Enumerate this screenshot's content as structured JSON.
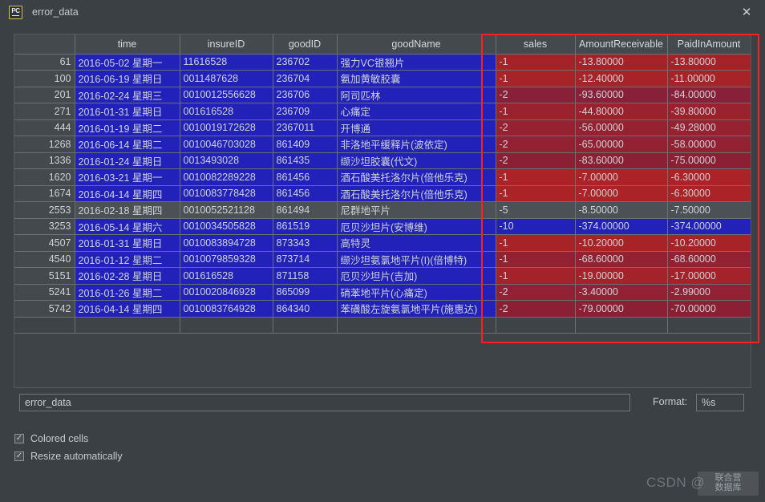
{
  "window": {
    "title": "error_data",
    "icon": "pc-app-icon",
    "close_label": "✕"
  },
  "table": {
    "columns": [
      "",
      "time",
      "insureID",
      "goodID",
      "goodName",
      "sales",
      "AmountReceivable",
      "PaidInAmount"
    ],
    "rows": [
      {
        "idx": "61",
        "time": "2016-05-02 星期一",
        "insureID": "11616528",
        "goodID": "236702",
        "goodName": "强力VC银翘片",
        "sales": "-1",
        "amountReceivable": "-13.80000",
        "paidInAmount": "-13.80000",
        "left_state": "selected",
        "right_state": "red",
        "right_shade": 0.04
      },
      {
        "idx": "100",
        "time": "2016-06-19 星期日",
        "insureID": "0011487628",
        "goodID": "236704",
        "goodName": "氨加黄敏胶囊",
        "sales": "-1",
        "amountReceivable": "-12.40000",
        "paidInAmount": "-11.00000",
        "left_state": "selected",
        "right_state": "red",
        "right_shade": 0.03
      },
      {
        "idx": "201",
        "time": "2016-02-24 星期三",
        "insureID": "0010012556628",
        "goodID": "236706",
        "goodName": "阿司匹林",
        "sales": "-2",
        "amountReceivable": "-93.60000",
        "paidInAmount": "-84.00000",
        "left_state": "selected",
        "right_state": "red",
        "right_shade": 0.25
      },
      {
        "idx": "271",
        "time": "2016-01-31 星期日",
        "insureID": "001616528",
        "goodID": "236709",
        "goodName": "心痛定",
        "sales": "-1",
        "amountReceivable": "-44.80000",
        "paidInAmount": "-39.80000",
        "left_state": "selected",
        "right_state": "red",
        "right_shade": 0.12
      },
      {
        "idx": "444",
        "time": "2016-01-19 星期二",
        "insureID": "0010019172628",
        "goodID": "2367011",
        "goodName": "开博通",
        "sales": "-2",
        "amountReceivable": "-56.00000",
        "paidInAmount": "-49.28000",
        "left_state": "selected",
        "right_state": "red",
        "right_shade": 0.15
      },
      {
        "idx": "1268",
        "time": "2016-06-14 星期二",
        "insureID": "0010046703028",
        "goodID": "861409",
        "goodName": "非洛地平缓释片(波依定)",
        "sales": "-2",
        "amountReceivable": "-65.00000",
        "paidInAmount": "-58.00000",
        "left_state": "selected",
        "right_state": "red",
        "right_shade": 0.17
      },
      {
        "idx": "1336",
        "time": "2016-01-24 星期日",
        "insureID": "0013493028",
        "goodID": "861435",
        "goodName": "缬沙坦胶囊(代文)",
        "sales": "-2",
        "amountReceivable": "-83.60000",
        "paidInAmount": "-75.00000",
        "left_state": "selected",
        "right_state": "red",
        "right_shade": 0.22
      },
      {
        "idx": "1620",
        "time": "2016-03-21 星期一",
        "insureID": "0010082289228",
        "goodID": "861456",
        "goodName": "酒石酸美托洛尔片(倍他乐克)",
        "sales": "-1",
        "amountReceivable": "-7.00000",
        "paidInAmount": "-6.30000",
        "left_state": "selected",
        "right_state": "red",
        "right_shade": 0.0
      },
      {
        "idx": "1674",
        "time": "2016-04-14 星期四",
        "insureID": "0010083778428",
        "goodID": "861456",
        "goodName": "酒石酸美托洛尔片(倍他乐克)",
        "sales": "-1",
        "amountReceivable": "-7.00000",
        "paidInAmount": "-6.30000",
        "left_state": "selected",
        "right_state": "red",
        "right_shade": 0.0
      },
      {
        "idx": "2553",
        "time": "2016-02-18 星期四",
        "insureID": "0010052521128",
        "goodID": "861494",
        "goodName": "尼群地平片",
        "sales": "-5",
        "amountReceivable": "-8.50000",
        "paidInAmount": "-7.50000",
        "left_state": "normal",
        "right_state": "normal",
        "right_shade": 0.0
      },
      {
        "idx": "3253",
        "time": "2016-05-14 星期六",
        "insureID": "0010034505828",
        "goodID": "861519",
        "goodName": "厄贝沙坦片(安博维)",
        "sales": "-10",
        "amountReceivable": "-374.00000",
        "paidInAmount": "-374.00000",
        "left_state": "selected",
        "right_state": "selected",
        "right_shade": 0.0
      },
      {
        "idx": "4507",
        "time": "2016-01-31 星期日",
        "insureID": "0010083894728",
        "goodID": "873343",
        "goodName": "高特灵",
        "sales": "-1",
        "amountReceivable": "-10.20000",
        "paidInAmount": "-10.20000",
        "left_state": "selected",
        "right_state": "red",
        "right_shade": 0.02
      },
      {
        "idx": "4540",
        "time": "2016-01-12 星期二",
        "insureID": "0010079859328",
        "goodID": "873714",
        "goodName": "缬沙坦氨氯地平片(I)(倍博特)",
        "sales": "-1",
        "amountReceivable": "-68.60000",
        "paidInAmount": "-68.60000",
        "left_state": "selected",
        "right_state": "red",
        "right_shade": 0.18
      },
      {
        "idx": "5151",
        "time": "2016-02-28 星期日",
        "insureID": "001616528",
        "goodID": "871158",
        "goodName": "厄贝沙坦片(吉加)",
        "sales": "-1",
        "amountReceivable": "-19.00000",
        "paidInAmount": "-17.00000",
        "left_state": "selected",
        "right_state": "red",
        "right_shade": 0.05
      },
      {
        "idx": "5241",
        "time": "2016-01-26 星期二",
        "insureID": "0010020846928",
        "goodID": "865099",
        "goodName": "硝苯地平片(心痛定)",
        "sales": "-2",
        "amountReceivable": "-3.40000",
        "paidInAmount": "-2.99000",
        "left_state": "selected",
        "right_state": "red",
        "right_shade": 0.18
      },
      {
        "idx": "5742",
        "time": "2016-04-14 星期四",
        "insureID": "0010083764928",
        "goodID": "864340",
        "goodName": "苯磺酸左旋氨氯地平片(施惠达)",
        "sales": "-2",
        "amountReceivable": "-79.00000",
        "paidInAmount": "-70.00000",
        "left_state": "selected",
        "right_state": "red",
        "right_shade": 0.22
      }
    ]
  },
  "annotation": {
    "shape": "rectangle",
    "color": "#fb2020"
  },
  "bottom": {
    "name_value": "error_data",
    "name_placeholder": "",
    "format_label": "Format:",
    "format_value": "%s",
    "checkboxes": [
      {
        "label": "Colored cells",
        "checked": true,
        "mark": "✓"
      },
      {
        "label": "Resize automatically",
        "checked": true,
        "mark": "✓"
      }
    ]
  },
  "watermark": {
    "text": "CSDN @",
    "badge_line1": "联合营",
    "badge_line2": "数据库"
  },
  "colors": {
    "window_bg": "#3b4045",
    "header_bg": "#44494e",
    "selection_blue": "#2222bb",
    "cell_red": "#ab2326",
    "cell_red_dark": "#7e1f3c",
    "annotation_red": "#fb2020",
    "text": "#c9cdd0"
  }
}
